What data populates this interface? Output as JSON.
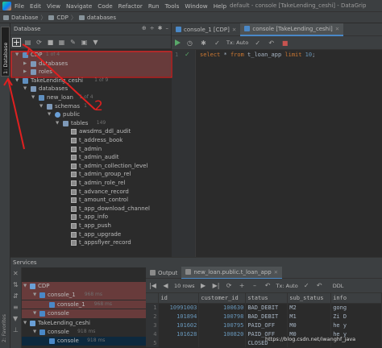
{
  "menubar": {
    "items": [
      "File",
      "Edit",
      "View",
      "Navigate",
      "Code",
      "Refactor",
      "Run",
      "Tools",
      "Window",
      "Help"
    ],
    "window_title": "default - console [TakeLending_ceshi] - DataGrip"
  },
  "breadcrumbs": [
    "Database",
    "CDP",
    "databases"
  ],
  "stripe": {
    "database_label": "1: Database",
    "favorites_label": "2: Favorites"
  },
  "db_panel": {
    "title": "Database",
    "tree": [
      {
        "label": "CDP",
        "count": "1 of 4",
        "level": 0,
        "expanded": true,
        "icon": "datasource",
        "highlight": "red"
      },
      {
        "label": "databases",
        "count": "",
        "level": 1,
        "expanded": false,
        "icon": "folder",
        "highlight": "red"
      },
      {
        "label": "roles",
        "count": "",
        "level": 1,
        "expanded": false,
        "icon": "folder",
        "highlight": "red"
      },
      {
        "label": "TakeLending_ceshi",
        "count": "1 of 9",
        "level": 0,
        "expanded": true,
        "icon": "datasource",
        "highlight": ""
      },
      {
        "label": "databases",
        "count": "",
        "level": 1,
        "expanded": true,
        "icon": "folder",
        "highlight": ""
      },
      {
        "label": "new_loan",
        "count": "1 of 4",
        "level": 2,
        "expanded": true,
        "icon": "datasource",
        "highlight": ""
      },
      {
        "label": "schemas",
        "count": "1",
        "level": 3,
        "expanded": true,
        "icon": "folder",
        "highlight": ""
      },
      {
        "label": "public",
        "count": "",
        "level": 4,
        "expanded": true,
        "icon": "schema",
        "highlight": ""
      },
      {
        "label": "tables",
        "count": "149",
        "level": 5,
        "expanded": true,
        "icon": "folder",
        "highlight": ""
      },
      {
        "label": "awsdms_ddl_audit",
        "count": "",
        "level": 6,
        "expanded": false,
        "icon": "table",
        "highlight": ""
      },
      {
        "label": "t_address_book",
        "count": "",
        "level": 6,
        "expanded": false,
        "icon": "table",
        "highlight": ""
      },
      {
        "label": "t_admin",
        "count": "",
        "level": 6,
        "expanded": false,
        "icon": "table",
        "highlight": ""
      },
      {
        "label": "t_admin_audit",
        "count": "",
        "level": 6,
        "expanded": false,
        "icon": "table",
        "highlight": ""
      },
      {
        "label": "t_admin_collection_level",
        "count": "",
        "level": 6,
        "expanded": false,
        "icon": "table",
        "highlight": ""
      },
      {
        "label": "t_admin_group_rel",
        "count": "",
        "level": 6,
        "expanded": false,
        "icon": "table",
        "highlight": ""
      },
      {
        "label": "t_admin_role_rel",
        "count": "",
        "level": 6,
        "expanded": false,
        "icon": "table",
        "highlight": ""
      },
      {
        "label": "t_advance_record",
        "count": "",
        "level": 6,
        "expanded": false,
        "icon": "table",
        "highlight": ""
      },
      {
        "label": "t_amount_control",
        "count": "",
        "level": 6,
        "expanded": false,
        "icon": "table",
        "highlight": ""
      },
      {
        "label": "t_app_download_channel",
        "count": "",
        "level": 6,
        "expanded": false,
        "icon": "table",
        "highlight": ""
      },
      {
        "label": "t_app_info",
        "count": "",
        "level": 6,
        "expanded": false,
        "icon": "table",
        "highlight": ""
      },
      {
        "label": "t_app_push",
        "count": "",
        "level": 6,
        "expanded": false,
        "icon": "table",
        "highlight": ""
      },
      {
        "label": "t_app_upgrade",
        "count": "",
        "level": 6,
        "expanded": false,
        "icon": "table",
        "highlight": ""
      },
      {
        "label": "t_appsflyer_record",
        "count": "",
        "level": 6,
        "expanded": false,
        "icon": "table",
        "highlight": ""
      }
    ]
  },
  "editor": {
    "tabs": [
      {
        "label": "console_1 [CDP]",
        "active": false
      },
      {
        "label": "console [TakeLending_ceshi]",
        "active": true
      }
    ],
    "tx_mode": "Tx: Auto",
    "line_number": "1",
    "code": {
      "kw1": "select",
      "star": " * ",
      "kw2": "from",
      "table": " t_loan_app ",
      "kw3": "limit",
      "limit": " 10",
      "semi": ";"
    }
  },
  "services": {
    "title": "Services",
    "tree": [
      {
        "label": "CDP",
        "time": "",
        "level": 0,
        "highlight": "red"
      },
      {
        "label": "console_1",
        "time": "968 ms",
        "level": 1,
        "highlight": "red"
      },
      {
        "label": "console_1",
        "time": "968 ms",
        "level": 2,
        "highlight": "red"
      },
      {
        "label": "console",
        "time": "",
        "level": 1,
        "highlight": "red"
      },
      {
        "label": "TakeLending_ceshi",
        "time": "",
        "level": 0,
        "highlight": ""
      },
      {
        "label": "console",
        "time": "918 ms",
        "level": 1,
        "highlight": ""
      },
      {
        "label": "console",
        "time": "918 ms",
        "level": 2,
        "highlight": "sel"
      }
    ]
  },
  "results": {
    "tabs": [
      "Output",
      "new_loan.public.t_loan_app"
    ],
    "rows_label": "10 rows",
    "tx_mode": "Tx: Auto",
    "ddl": "DDL",
    "columns": [
      "id",
      "customer_id",
      "status",
      "sub_status",
      "info"
    ],
    "rows": [
      [
        "1",
        "10991003",
        "100630",
        "BAD_DEBIT",
        "M2",
        "gong"
      ],
      [
        "2",
        "101894",
        "100798",
        "BAD_DEBIT",
        "M1",
        "Zi D"
      ],
      [
        "3",
        "101602",
        "100795",
        "PAID_OFF",
        "M0",
        "he y"
      ],
      [
        "4",
        "101628",
        "100820",
        "PAID_OFF",
        "M0",
        "he y"
      ],
      [
        "5",
        "",
        "",
        "CLOSED",
        "",
        ""
      ]
    ]
  },
  "annotation": {
    "number": "2"
  },
  "watermark": "https://blog.csdn.net/iwanghf_java"
}
